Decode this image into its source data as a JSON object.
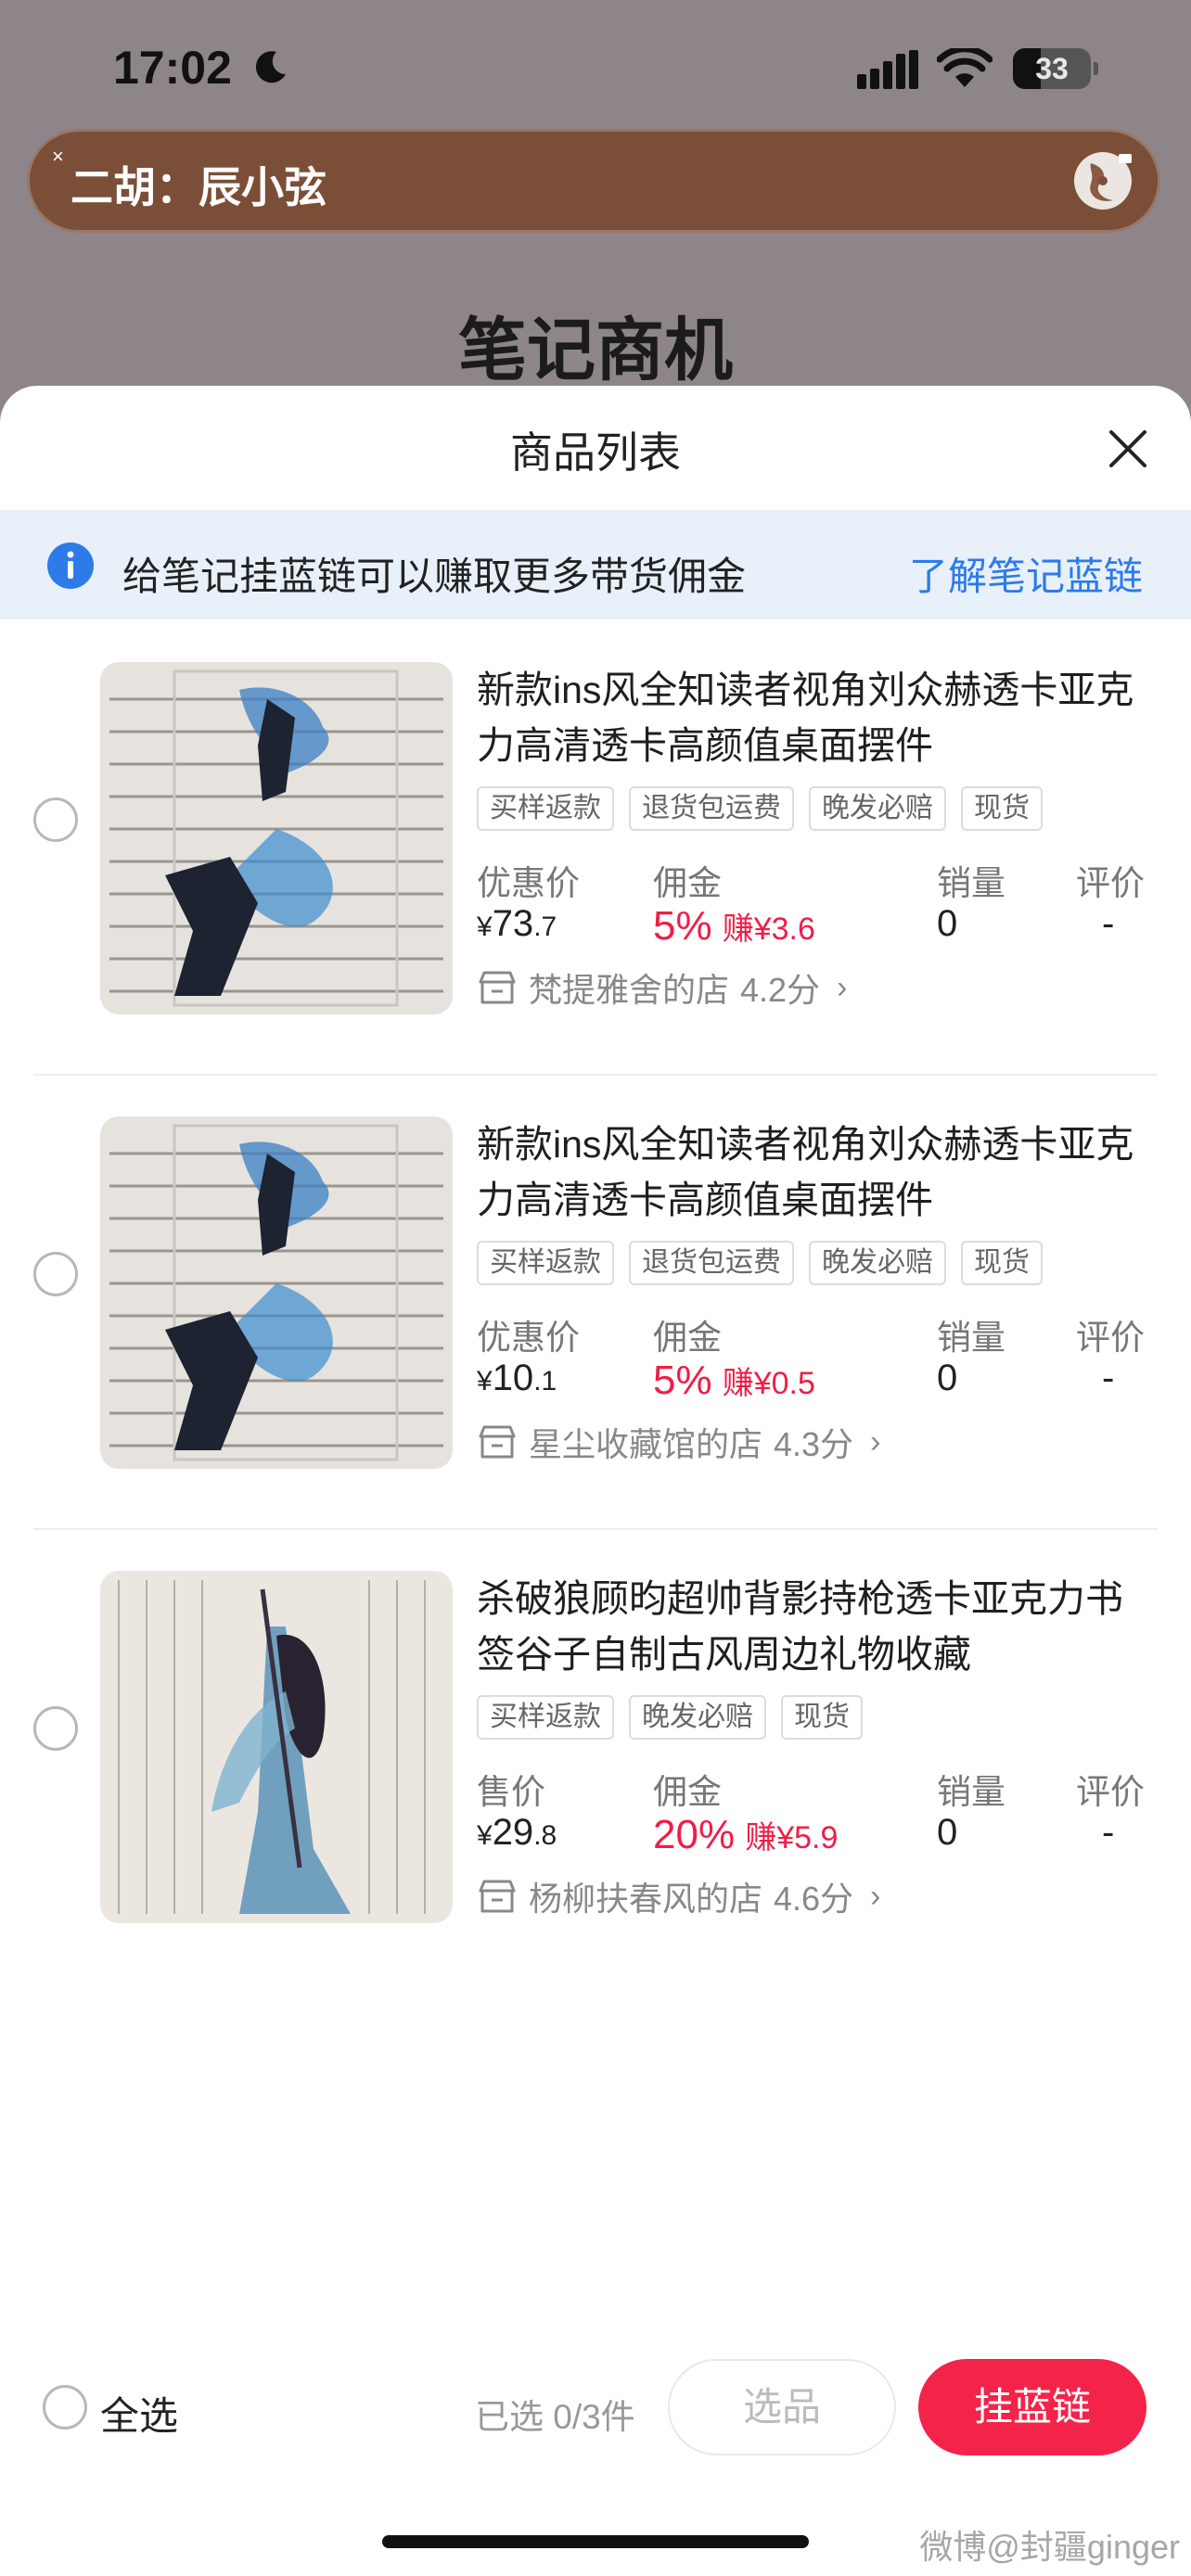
{
  "status": {
    "time": "17:02",
    "battery": "33"
  },
  "banner": {
    "close": "×",
    "title": "二胡：辰小弦"
  },
  "page_heading": "笔记商机",
  "sheet": {
    "title": "商品列表"
  },
  "notice": {
    "text": "给笔记挂蓝链可以赚取更多带货佣金",
    "link": "了解笔记蓝链"
  },
  "labels": {
    "commission": "佣金",
    "sales": "销量",
    "rating": "评价",
    "yen": "¥"
  },
  "items": [
    {
      "name": "新款ins风全知读者视角刘众赫透卡亚克力高清透卡高颜值桌面摆件",
      "tags": [
        "买样返款",
        "退货包运费",
        "晚发必赔",
        "现货"
      ],
      "price_label": "优惠价",
      "price_int": "73",
      "price_dec": ".7",
      "commission_pct": "5%",
      "commission_earn": "赚¥3.6",
      "sales": "0",
      "rating": "-",
      "store": "梵提雅舍的店",
      "store_score": "4.2分"
    },
    {
      "name": "新款ins风全知读者视角刘众赫透卡亚克力高清透卡高颜值桌面摆件",
      "tags": [
        "买样返款",
        "退货包运费",
        "晚发必赔",
        "现货"
      ],
      "price_label": "优惠价",
      "price_int": "10",
      "price_dec": ".1",
      "commission_pct": "5%",
      "commission_earn": "赚¥0.5",
      "sales": "0",
      "rating": "-",
      "store": "星尘收藏馆的店",
      "store_score": "4.3分"
    },
    {
      "name": "杀破狼顾昀超帅背影持枪透卡亚克力书签谷子自制古风周边礼物收藏",
      "tags": [
        "买样返款",
        "晚发必赔",
        "现货"
      ],
      "price_label": "售价",
      "price_int": "29",
      "price_dec": ".8",
      "commission_pct": "20%",
      "commission_earn": "赚¥5.9",
      "sales": "0",
      "rating": "-",
      "store": "杨柳扶春风的店",
      "store_score": "4.6分"
    }
  ],
  "bottom": {
    "select_all": "全选",
    "selected_count": "已选 0/3件",
    "select_button": "选品",
    "hang_button": "挂蓝链"
  },
  "watermark": "微博@封疆ginger",
  "colors": {
    "accent_red": "#f01d46",
    "link_blue": "#2d7be8",
    "notice_bg": "#e8f0fa"
  }
}
